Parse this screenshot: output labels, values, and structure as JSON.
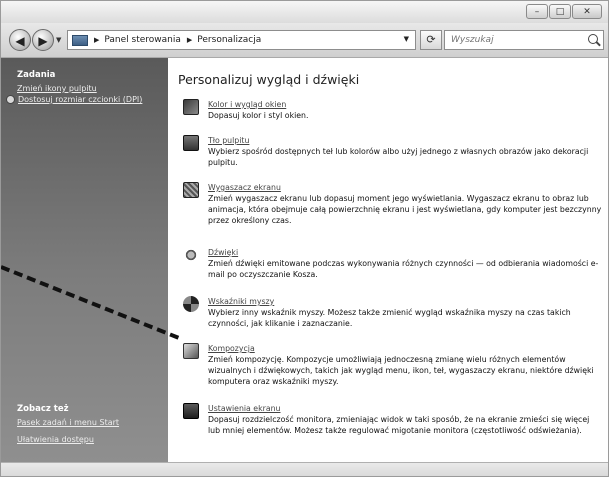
{
  "address": {
    "crumbs": [
      "Panel sterowania",
      "Personalizacja"
    ],
    "search_placeholder": "Wyszukaj"
  },
  "sidebar": {
    "tasks_heading": "Zadania",
    "tasks": [
      "Zmień ikony pulpitu",
      "Dostosuj rozmiar czcionki (DPI)"
    ],
    "see_also_heading": "Zobacz też",
    "see_also": [
      "Pasek zadań i menu Start",
      "Ułatwienia dostępu"
    ]
  },
  "main": {
    "title": "Personalizuj wygląd i dźwięki",
    "items": [
      {
        "title": "Kolor i wygląd okien",
        "desc": "Dopasuj kolor i styl okien."
      },
      {
        "title": "Tło pulpitu",
        "desc": "Wybierz spośród dostępnych teł lub kolorów albo użyj jednego z własnych obrazów jako dekoracji pulpitu."
      },
      {
        "title": "Wygaszacz ekranu",
        "desc": "Zmień wygaszacz ekranu lub dopasuj moment jego wyświetlania. Wygaszacz ekranu to obraz lub animacja, która obejmuje całą powierzchnię ekranu i jest wyświetlana, gdy komputer jest bezczynny przez określony czas."
      },
      {
        "title": "Dźwięki",
        "desc": "Zmień dźwięki emitowane podczas wykonywania różnych czynności — od odbierania wiadomości e-mail po oczyszczanie Kosza."
      },
      {
        "title": "Wskaźniki myszy",
        "desc": "Wybierz inny wskaźnik myszy. Możesz także zmienić wygląd wskaźnika myszy na czas takich czynności, jak klikanie i zaznaczanie."
      },
      {
        "title": "Kompozycja",
        "desc": "Zmień kompozycję. Kompozycje umożliwiają jednoczesną zmianę wielu różnych elementów wizualnych i dźwiękowych, takich jak wygląd menu, ikon, teł, wygaszaczy ekranu, niektóre dźwięki komputera oraz wskaźniki myszy."
      },
      {
        "title": "Ustawienia ekranu",
        "desc": "Dopasuj rozdzielczość monitora, zmieniając widok w taki sposób, że na ekranie zmieści się więcej lub mniej elementów. Możesz także regulować migotanie monitora (częstotliwość odświeżania)."
      }
    ]
  }
}
